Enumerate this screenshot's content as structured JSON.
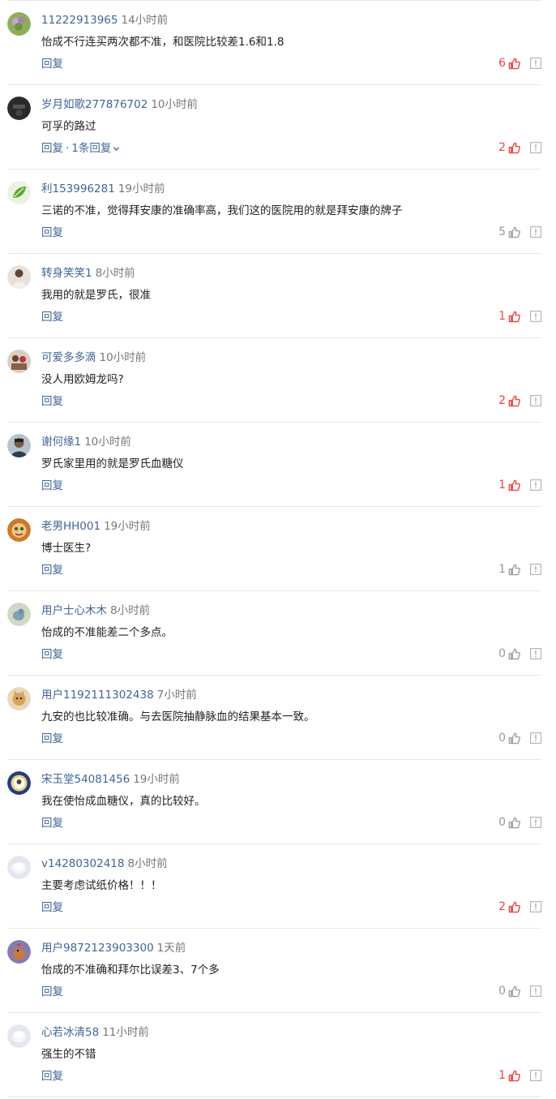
{
  "accent_color": "#406599",
  "like_active_color": "#f04142",
  "like_inactive_color": "#999999",
  "reply_label": "回复",
  "comments": [
    {
      "username": "11222913965",
      "time": "14小时前",
      "content": "怡成不行连买两次都不准，和医院比较差1.6和1.8",
      "likes": "6",
      "liked": true,
      "replies": "",
      "avatar": "flower"
    },
    {
      "username": "岁月如歌277876702",
      "time": "10小时前",
      "content": "可孚的路过",
      "likes": "2",
      "liked": true,
      "replies": "1条回复",
      "avatar": "dark"
    },
    {
      "username": "利153996281",
      "time": "19小时前",
      "content": "三诺的不准，觉得拜安康的准确率高，我们这的医院用的就是拜安康的牌子",
      "likes": "5",
      "liked": false,
      "replies": "",
      "avatar": "leaf"
    },
    {
      "username": "转身笑笑1",
      "time": "8小时前",
      "content": "我用的就是罗氏，很准",
      "likes": "1",
      "liked": true,
      "replies": "",
      "avatar": "person-light"
    },
    {
      "username": "可爱多多滴",
      "time": "10小时前",
      "content": "没人用欧姆龙吗?",
      "likes": "2",
      "liked": true,
      "replies": "",
      "avatar": "group"
    },
    {
      "username": "谢何缘1",
      "time": "10小时前",
      "content": "罗氏家里用的就是罗氏血糖仪",
      "likes": "1",
      "liked": true,
      "replies": "",
      "avatar": "man"
    },
    {
      "username": "老男HH001",
      "time": "19小时前",
      "content": "博士医生?",
      "likes": "1",
      "liked": false,
      "replies": "",
      "avatar": "cartoon"
    },
    {
      "username": "用户士心木木",
      "time": "8小时前",
      "content": "怡成的不准能差二个多点。",
      "likes": "0",
      "liked": false,
      "replies": "",
      "avatar": "bird"
    },
    {
      "username": "用户1192111302438",
      "time": "7小时前",
      "content": "九安的也比较准确。与去医院抽静脉血的结果基本一致。",
      "likes": "0",
      "liked": false,
      "replies": "",
      "avatar": "cat"
    },
    {
      "username": "宋玉堂54081456",
      "time": "19小时前",
      "content": "我在使怡成血糖仪，真的比较好。",
      "likes": "0",
      "liked": false,
      "replies": "",
      "avatar": "emblem"
    },
    {
      "username": "v14280302418",
      "time": "8小时前",
      "content": "主要考虑试纸价格！！！",
      "likes": "2",
      "liked": true,
      "replies": "",
      "avatar": "default"
    },
    {
      "username": "用户9872123903300",
      "time": "1天前",
      "content": "怡成的不准确和拜尔比误差3、7个多",
      "likes": "0",
      "liked": false,
      "replies": "",
      "avatar": "rooster"
    },
    {
      "username": "心若冰清58",
      "time": "11小时前",
      "content": "强生的不错",
      "likes": "1",
      "liked": true,
      "replies": "",
      "avatar": "default"
    }
  ]
}
